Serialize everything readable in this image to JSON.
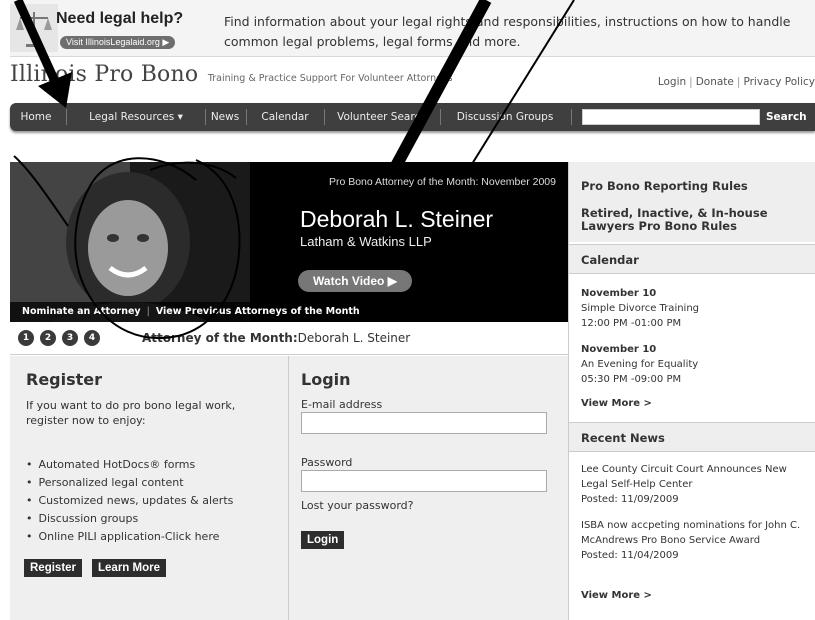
{
  "banner": {
    "title": "Need legal help?",
    "button": "Visit IllinoisLegalaid.org ▶",
    "text": "Find information about your legal rights and responsibilities, instructions on how to handle common legal problems, legal forms and more."
  },
  "header": {
    "logo": "Illinois Pro Bono",
    "tagline": "Training & Practice Support For Volunteer Attorneys",
    "links": [
      "Login",
      "Donate",
      "Privacy Policy"
    ]
  },
  "nav": {
    "items": [
      "Home",
      "Legal Resources ▾",
      "News",
      "Calendar",
      "Volunteer Search",
      "Discussion Groups"
    ],
    "search_button": "Search"
  },
  "hero": {
    "overline": "Pro Bono Attorney of the Month: November 2009",
    "name": "Deborah L. Steiner",
    "firm": "Latham & Watkins LLP",
    "video_button": "Watch Video ▶",
    "bar_links": [
      "Nominate an Attorney",
      "View Previous Attorneys of the Month"
    ]
  },
  "pager": {
    "pages": [
      "1",
      "2",
      "3",
      "4"
    ],
    "label_prefix": "Attorney of the Month:",
    "label_name": "Deborah L. Steiner"
  },
  "register": {
    "heading": "Register",
    "intro": "If you want to do pro bono legal work, register now to enjoy:",
    "benefits": [
      "Automated HotDocs® forms",
      "Personalized legal content",
      "Customized news, updates & alerts",
      "Discussion groups",
      "Online PILI application-Click here"
    ],
    "register_button": "Register",
    "learn_more_button": "Learn More"
  },
  "login": {
    "heading": "Login",
    "email_label": "E-mail address",
    "email_value": "",
    "password_label": "Password",
    "password_value": "",
    "lost_password": "Lost your password?",
    "button": "Login"
  },
  "sidebar": {
    "top_links": [
      "Pro Bono Reporting Rules",
      "Retired, Inactive, & In-house Lawyers Pro Bono Rules"
    ],
    "calendar": {
      "heading": "Calendar",
      "events": [
        {
          "date": "November 10",
          "title": "Simple Divorce Training",
          "time": "12:00 PM -01:00 PM"
        },
        {
          "date": "November 10",
          "title": "An Evening for Equality",
          "time": "05:30 PM -09:00 PM"
        }
      ],
      "more": "View More >"
    },
    "news": {
      "heading": "Recent News",
      "items": [
        {
          "title": "Lee County Circuit Court Announces New Legal Self-Help Center",
          "posted": "Posted: 11/09/2009"
        },
        {
          "title": "ISBA now accpeting nominations for John C. McAndrews Pro Bono Service Award",
          "posted": "Posted: 11/04/2009"
        }
      ],
      "more": "View More >"
    }
  },
  "colors": {
    "nav_bg": "#3f3f3f",
    "hero_bg": "#000000",
    "panel_bg": "#efefef",
    "button_bg": "#2d2d2d"
  }
}
